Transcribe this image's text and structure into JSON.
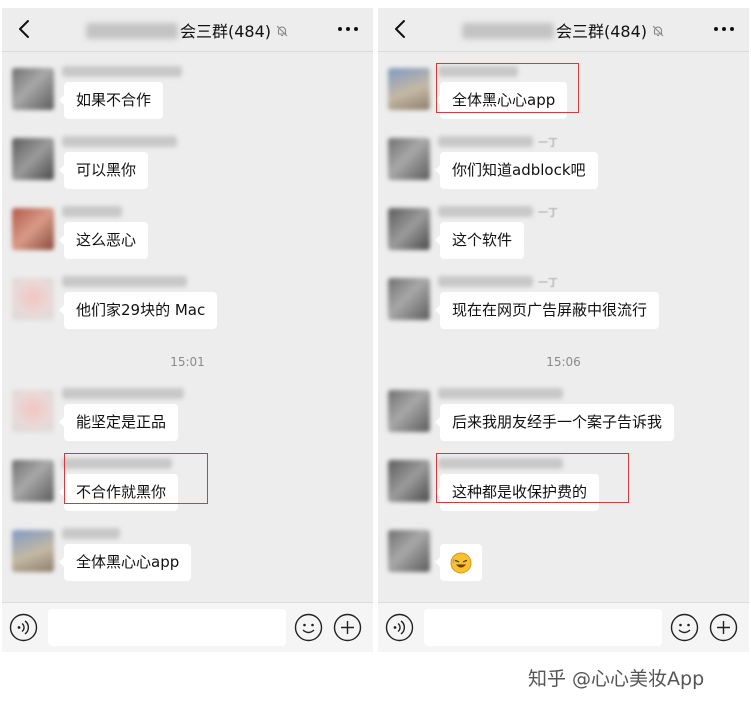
{
  "left_screen": {
    "title_suffix": "会三群(484)",
    "messages": [
      {
        "text": "如果不合作"
      },
      {
        "text": "可以黑你"
      },
      {
        "text": "这么恶心"
      },
      {
        "text": "他们家29块的 Mac"
      },
      {
        "text": "能坚定是正品"
      },
      {
        "text": "不合作就黑你"
      },
      {
        "text": "全体黑心心app"
      }
    ],
    "timestamp": "15:01"
  },
  "right_screen": {
    "title_suffix": "会三群(484)",
    "messages": [
      {
        "text": "全体黑心心app"
      },
      {
        "text": "你们知道adblock吧",
        "nick_tail": "一丁"
      },
      {
        "text": "这个软件",
        "nick_tail": "一丁"
      },
      {
        "text": "现在在网页广告屏蔽中很流行",
        "nick_tail": "一丁"
      },
      {
        "text": "后来我朋友经手一个案子告诉我"
      },
      {
        "text": "这种都是收保护费的"
      }
    ],
    "timestamp": "15:06"
  },
  "icons": {
    "back": "chevron-left-icon",
    "mute": "bell-off-icon",
    "more": "more-dots-icon",
    "voice": "voice-icon",
    "emoji": "smiley-icon",
    "plus": "plus-icon",
    "sticker": "laughing-emoji-icon"
  },
  "colors": {
    "chat_background": "#ededed",
    "bubble": "#ffffff",
    "highlight_box": "#d03b3b"
  },
  "watermark": "知乎 @心心美妆App"
}
